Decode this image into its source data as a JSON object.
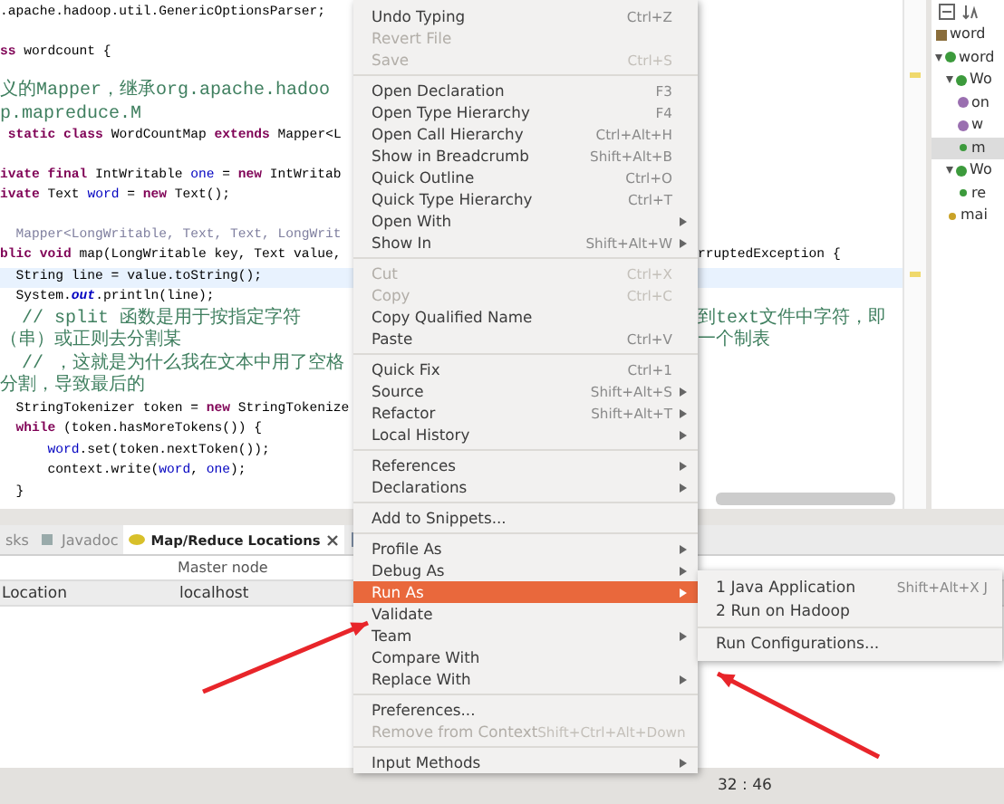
{
  "editor": {
    "lines": [
      {
        "gap_before": false,
        "current": false,
        "segments": [
          {
            "kind": "plain",
            "text": ".apache.hadoop.util.GenericOptionsParser;"
          }
        ]
      },
      {
        "gap_before": true,
        "current": false,
        "segments": [
          {
            "kind": "kw",
            "text": "ss"
          },
          {
            "kind": "plain",
            "text": " wordcount {"
          }
        ]
      },
      {
        "gap_before": true,
        "current": false,
        "segments": [
          {
            "kind": "comment",
            "text": "义的Mapper，继承org.apache.hadoop.mapreduce.M"
          }
        ]
      },
      {
        "gap_before": false,
        "current": false,
        "segments": [
          {
            "kind": "kw",
            "text": " static class "
          },
          {
            "kind": "plain",
            "text": "WordCountMap "
          },
          {
            "kind": "kw",
            "text": "extends "
          },
          {
            "kind": "plain",
            "text": "Mapper<L"
          }
        ]
      },
      {
        "gap_before": true,
        "current": false,
        "segments": [
          {
            "kind": "kw",
            "text": "ivate final "
          },
          {
            "kind": "plain",
            "text": "IntWritable "
          },
          {
            "kind": "field",
            "text": "one"
          },
          {
            "kind": "plain",
            "text": " = "
          },
          {
            "kind": "kw",
            "text": "new "
          },
          {
            "kind": "plain",
            "text": "IntWritab"
          }
        ]
      },
      {
        "gap_before": false,
        "current": false,
        "segments": [
          {
            "kind": "kw",
            "text": "ivate "
          },
          {
            "kind": "plain",
            "text": "Text "
          },
          {
            "kind": "field",
            "text": "word"
          },
          {
            "kind": "plain",
            "text": " = "
          },
          {
            "kind": "kw",
            "text": "new "
          },
          {
            "kind": "plain",
            "text": "Text();"
          }
        ]
      },
      {
        "gap_before": true,
        "current": false,
        "segments": [
          {
            "kind": "doc",
            "text": "  Mapper<LongWritable, Text, Text, LongWrit"
          }
        ]
      },
      {
        "gap_before": false,
        "current": false,
        "segments": [
          {
            "kind": "kw",
            "text": "blic void "
          },
          {
            "kind": "plain",
            "text": "map(LongWritable key, Text value,"
          }
        ],
        "right_text": "rruptedException {"
      },
      {
        "gap_before": false,
        "current": true,
        "segments": [
          {
            "kind": "plain",
            "text": "  String line = value.toString();"
          }
        ]
      },
      {
        "gap_before": false,
        "current": false,
        "segments": [
          {
            "kind": "plain",
            "text": "  System."
          },
          {
            "kind": "static",
            "text": "out"
          },
          {
            "kind": "plain",
            "text": ".println(line);"
          }
        ]
      },
      {
        "gap_before": false,
        "current": false,
        "segments": [
          {
            "kind": "comment",
            "text": "  // split 函数是用于按指定字符（串）或正则去分割某"
          }
        ],
        "right_text": "到text文件中字符，即一个制表"
      },
      {
        "gap_before": false,
        "current": false,
        "segments": [
          {
            "kind": "comment",
            "text": "  // ，这就是为什么我在文本中用了空格分割，导致最后的"
          }
        ]
      },
      {
        "gap_before": false,
        "current": false,
        "segments": [
          {
            "kind": "plain",
            "text": "  StringTokenizer token = "
          },
          {
            "kind": "kw",
            "text": "new "
          },
          {
            "kind": "plain",
            "text": "StringTokenize"
          }
        ]
      },
      {
        "gap_before": false,
        "current": false,
        "segments": [
          {
            "kind": "kw",
            "text": "  while "
          },
          {
            "kind": "plain",
            "text": "(token.hasMoreTokens()) {"
          }
        ]
      },
      {
        "gap_before": false,
        "current": false,
        "segments": [
          {
            "kind": "field",
            "text": "      word"
          },
          {
            "kind": "plain",
            "text": ".set(token.nextToken());"
          }
        ]
      },
      {
        "gap_before": false,
        "current": false,
        "segments": [
          {
            "kind": "plain",
            "text": "      context.write("
          },
          {
            "kind": "field",
            "text": "word"
          },
          {
            "kind": "plain",
            "text": ", "
          },
          {
            "kind": "field",
            "text": "one"
          },
          {
            "kind": "plain",
            "text": ");"
          }
        ]
      },
      {
        "gap_before": false,
        "current": false,
        "segments": [
          {
            "kind": "plain",
            "text": "  }"
          }
        ]
      }
    ]
  },
  "outline": {
    "items": [
      {
        "label": "word",
        "kind": "import",
        "selected": false
      },
      {
        "label": "word",
        "kind": "class",
        "selected": false,
        "expanded": true,
        "children": [
          {
            "label": "Wo",
            "kind": "class",
            "selected": false,
            "expanded": true,
            "children": [
              {
                "label": "on",
                "kind": "field",
                "selected": false
              },
              {
                "label": "w",
                "kind": "field",
                "selected": false
              },
              {
                "label": "m",
                "kind": "method",
                "selected": true
              }
            ]
          },
          {
            "label": "Wo",
            "kind": "class",
            "selected": false,
            "expanded": true,
            "children": [
              {
                "label": "re",
                "kind": "method",
                "selected": false
              }
            ]
          },
          {
            "label": "mai",
            "kind": "static-method",
            "selected": false
          }
        ]
      }
    ]
  },
  "bottom_panel": {
    "tabs": [
      {
        "label": "sks",
        "kind": "tasks",
        "selected": false
      },
      {
        "label": "Javadoc",
        "kind": "javadoc",
        "selected": false
      },
      {
        "label": "Map/Reduce Locations",
        "kind": "mapreduce",
        "selected": true
      }
    ],
    "table": {
      "group_header": "Master node",
      "rows": [
        {
          "cells": [
            "Location",
            "localhost"
          ],
          "selected": true
        }
      ]
    }
  },
  "status_bar": {
    "position": "32 : 46"
  },
  "context_menu": {
    "groups": [
      [
        {
          "label": "Undo Typing",
          "shortcut": "Ctrl+Z",
          "disabled": false,
          "selected": false,
          "has_submenu": false
        },
        {
          "label": "Revert File",
          "disabled": true,
          "selected": false,
          "has_submenu": false
        },
        {
          "label": "Save",
          "shortcut": "Ctrl+S",
          "disabled": true,
          "selected": false,
          "has_submenu": false
        }
      ],
      [
        {
          "label": "Open Declaration",
          "shortcut": "F3",
          "disabled": false,
          "selected": false,
          "has_submenu": false
        },
        {
          "label": "Open Type Hierarchy",
          "shortcut": "F4",
          "disabled": false,
          "selected": false,
          "has_submenu": false
        },
        {
          "label": "Open Call Hierarchy",
          "shortcut": "Ctrl+Alt+H",
          "disabled": false,
          "selected": false,
          "has_submenu": false
        },
        {
          "label": "Show in Breadcrumb",
          "shortcut": "Shift+Alt+B",
          "disabled": false,
          "selected": false,
          "has_submenu": false
        },
        {
          "label": "Quick Outline",
          "shortcut": "Ctrl+O",
          "disabled": false,
          "selected": false,
          "has_submenu": false
        },
        {
          "label": "Quick Type Hierarchy",
          "shortcut": "Ctrl+T",
          "disabled": false,
          "selected": false,
          "has_submenu": false
        },
        {
          "label": "Open With",
          "disabled": false,
          "selected": false,
          "has_submenu": true
        },
        {
          "label": "Show In",
          "shortcut": "Shift+Alt+W",
          "disabled": false,
          "selected": false,
          "has_submenu": true
        }
      ],
      [
        {
          "label": "Cut",
          "shortcut": "Ctrl+X",
          "disabled": true,
          "selected": false,
          "has_submenu": false
        },
        {
          "label": "Copy",
          "shortcut": "Ctrl+C",
          "disabled": true,
          "selected": false,
          "has_submenu": false
        },
        {
          "label": "Copy Qualified Name",
          "disabled": false,
          "selected": false,
          "has_submenu": false
        },
        {
          "label": "Paste",
          "shortcut": "Ctrl+V",
          "disabled": false,
          "selected": false,
          "has_submenu": false
        }
      ],
      [
        {
          "label": "Quick Fix",
          "shortcut": "Ctrl+1",
          "disabled": false,
          "selected": false,
          "has_submenu": false
        },
        {
          "label": "Source",
          "shortcut": "Shift+Alt+S",
          "disabled": false,
          "selected": false,
          "has_submenu": true
        },
        {
          "label": "Refactor",
          "shortcut": "Shift+Alt+T",
          "disabled": false,
          "selected": false,
          "has_submenu": true
        },
        {
          "label": "Local History",
          "disabled": false,
          "selected": false,
          "has_submenu": true
        }
      ],
      [
        {
          "label": "References",
          "disabled": false,
          "selected": false,
          "has_submenu": true
        },
        {
          "label": "Declarations",
          "disabled": false,
          "selected": false,
          "has_submenu": true
        }
      ],
      [
        {
          "label": "Add to Snippets...",
          "disabled": false,
          "selected": false,
          "has_submenu": false
        }
      ],
      [
        {
          "label": "Profile As",
          "disabled": false,
          "selected": false,
          "has_submenu": true
        },
        {
          "label": "Debug As",
          "disabled": false,
          "selected": false,
          "has_submenu": true
        },
        {
          "label": "Run As",
          "disabled": false,
          "selected": true,
          "has_submenu": true,
          "submenu": [
            [
              {
                "label": "1 Java Application",
                "shortcut": "Shift+Alt+X J"
              },
              {
                "label": "2 Run on Hadoop"
              }
            ],
            [
              {
                "label": "Run Configurations..."
              }
            ]
          ]
        },
        {
          "label": "Validate",
          "disabled": false,
          "selected": false,
          "has_submenu": false
        },
        {
          "label": "Team",
          "disabled": false,
          "selected": false,
          "has_submenu": true
        },
        {
          "label": "Compare With",
          "disabled": false,
          "selected": false,
          "has_submenu": false
        },
        {
          "label": "Replace With",
          "disabled": false,
          "selected": false,
          "has_submenu": true
        }
      ],
      [
        {
          "label": "Preferences...",
          "disabled": false,
          "selected": false,
          "has_submenu": false
        },
        {
          "label": "Remove from Context",
          "shortcut": "Shift+Ctrl+Alt+Down",
          "disabled": true,
          "selected": false,
          "has_submenu": false
        }
      ],
      [
        {
          "label": "Input Methods",
          "disabled": false,
          "selected": false,
          "has_submenu": true
        }
      ]
    ]
  },
  "annotations": [
    {
      "kind": "arrow"
    },
    {
      "kind": "arrow"
    }
  ]
}
